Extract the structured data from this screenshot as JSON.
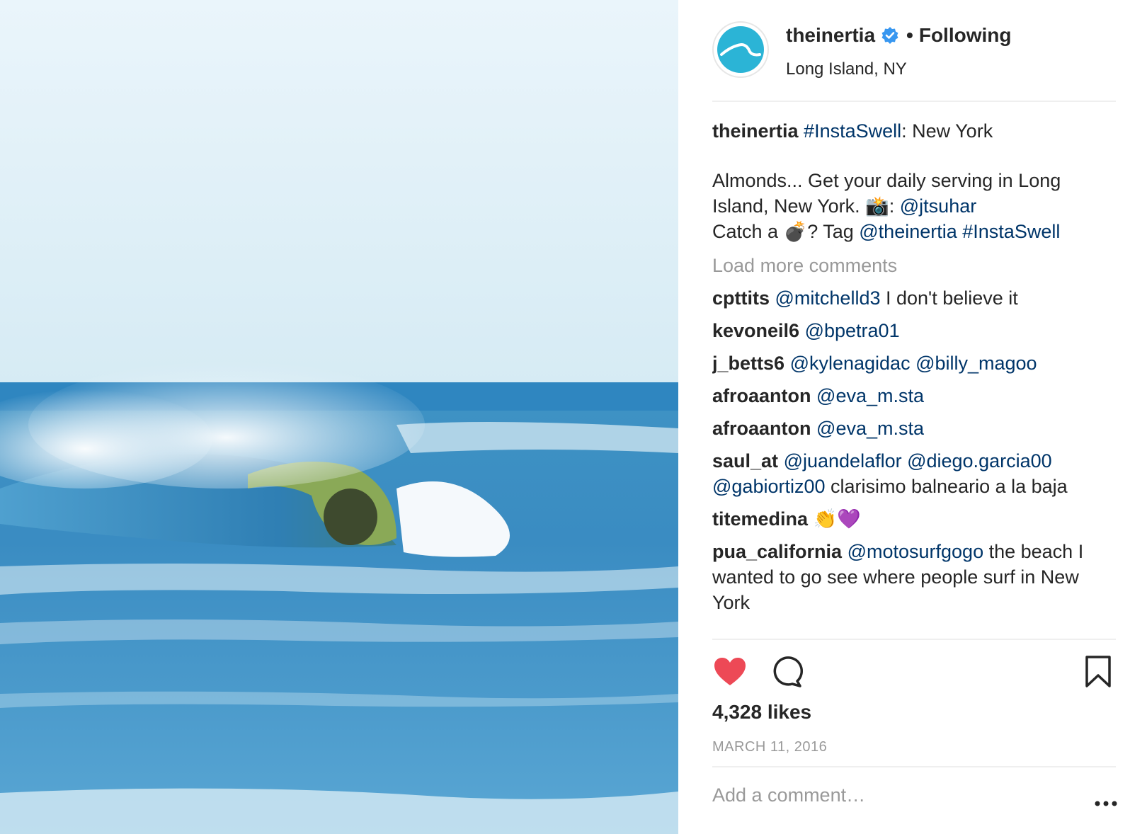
{
  "post": {
    "photo_icon": "ocean-wave-photo"
  },
  "header": {
    "username": "theinertia",
    "verified_icon": "verified-badge-icon",
    "separator": "•",
    "follow_status": "Following",
    "location": "Long Island, NY"
  },
  "caption": {
    "username": "theinertia",
    "hashtag": "#InstaSwell",
    "title_rest": ": New York",
    "line1": "Almonds... Get your daily serving in Long Island, New York. ",
    "camera_emoji": "📸",
    "colon": ": ",
    "credit": "@jtsuhar",
    "line2_a": "Catch a ",
    "bomb_emoji": "💣",
    "line2_b": "? Tag ",
    "tag_mention": "@theinertia",
    "tag_hashtag": "#InstaSwell"
  },
  "load_more": "Load more comments",
  "comments": [
    {
      "user": "cpttits",
      "mentions": "@mitchelld3",
      "text": " I don't believe it"
    },
    {
      "user": "kevoneil6",
      "mentions": "@bpetra01",
      "text": ""
    },
    {
      "user": "j_betts6",
      "mentions": "@kylenagidac @billy_magoo",
      "text": ""
    },
    {
      "user": "afroaanton",
      "mentions": "@eva_m.sta",
      "text": ""
    },
    {
      "user": "afroaanton",
      "mentions": "@eva_m.sta",
      "text": ""
    },
    {
      "user": "saul_at",
      "mentions": "@juandelaflor @diego.garcia00 @gabiortiz00",
      "text": " clarisimo balneario a la baja"
    },
    {
      "user": "titemedina",
      "mentions": "",
      "text": "👏💜"
    },
    {
      "user": "pua_california",
      "mentions": "@motosurfgogo",
      "text": " the beach I wanted to go see where people surf in New York"
    }
  ],
  "actions": {
    "like_icon": "heart-icon",
    "comment_icon": "comment-bubble-icon",
    "save_icon": "bookmark-icon",
    "like_color": "#ed4956"
  },
  "likes": "4,328 likes",
  "date": "MARCH 11, 2016",
  "add_comment": {
    "placeholder": "Add a comment…"
  },
  "more_icon": "ellipsis-icon",
  "colors": {
    "link": "#003569",
    "muted": "#999999",
    "avatar": "#2bb4d6",
    "verified": "#3897f0"
  }
}
